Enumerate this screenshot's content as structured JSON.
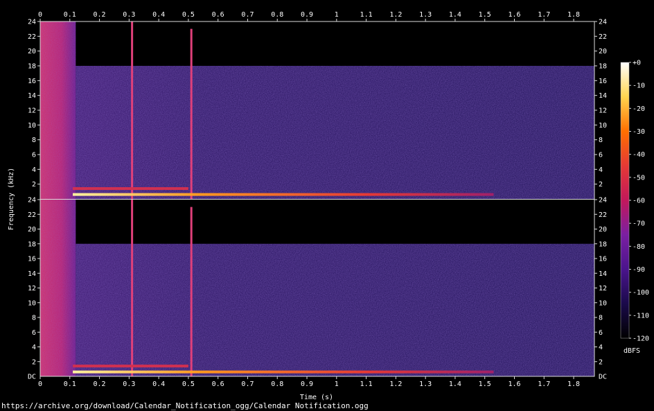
{
  "source_url": "https://archive.org/download/Calendar_Notification_ogg/Calendar Notification.ogg",
  "chart_data": {
    "type": "heatmap",
    "subtype": "spectrogram",
    "channels": 2,
    "xlabel": "Time (s)",
    "ylabel": "Frequency (kHz)",
    "xlim": [
      0,
      1.87
    ],
    "ylim_khz": [
      0,
      24
    ],
    "x_ticks": [
      "0",
      "0.1",
      "0.2",
      "0.3",
      "0.4",
      "0.5",
      "0.6",
      "0.7",
      "0.8",
      "0.9",
      "1",
      "1.1",
      "1.2",
      "1.3",
      "1.4",
      "1.5",
      "1.6",
      "1.7",
      "1.8"
    ],
    "x_tick_values": [
      0,
      0.1,
      0.2,
      0.3,
      0.4,
      0.5,
      0.6,
      0.7,
      0.8,
      0.9,
      1.0,
      1.1,
      1.2,
      1.3,
      1.4,
      1.5,
      1.6,
      1.7,
      1.8
    ],
    "y_ticks": [
      "24",
      "22",
      "20",
      "18",
      "16",
      "14",
      "12",
      "10",
      "8",
      "6",
      "4",
      "2"
    ],
    "y_tick_values": [
      24,
      22,
      20,
      18,
      16,
      14,
      12,
      10,
      8,
      6,
      4,
      2
    ],
    "y_bottom_label": "DC",
    "colorbar": {
      "label": "dBFS",
      "ticks": [
        "+0",
        "-10",
        "-20",
        "-30",
        "-40",
        "-50",
        "-60",
        "-70",
        "-80",
        "-90",
        "-100",
        "-110",
        "-120"
      ],
      "tick_values": [
        0,
        -10,
        -20,
        -30,
        -40,
        -50,
        -60,
        -70,
        -80,
        -90,
        -100,
        -110,
        -120
      ],
      "range": [
        -120,
        0
      ],
      "colors": [
        "#000000",
        "#1a0a4a",
        "#4a148c",
        "#7b1fa2",
        "#c2185b",
        "#e53935",
        "#ff6f00",
        "#ffd54f",
        "#ffffff"
      ]
    },
    "events": [
      {
        "name": "onset",
        "t_start": 0.0,
        "t_end": 0.12,
        "f_max_khz": 24,
        "level_db": -45
      },
      {
        "name": "click",
        "t": 0.31,
        "f_max_khz": 24,
        "level_db": -40
      },
      {
        "name": "click",
        "t": 0.51,
        "f_max_khz": 23,
        "level_db": -40
      }
    ],
    "tones": [
      {
        "name": "tone-low",
        "t_start": 0.11,
        "t_end": 1.53,
        "f_khz": 0.6,
        "level_db": -25
      },
      {
        "name": "tone-high",
        "t_start": 0.11,
        "t_end": 0.5,
        "f_khz": 1.4,
        "level_db": -40
      }
    ],
    "noise_floor": {
      "t_start": 0.12,
      "t_end": 1.87,
      "f_max_khz": 18,
      "level_db": -100
    }
  }
}
